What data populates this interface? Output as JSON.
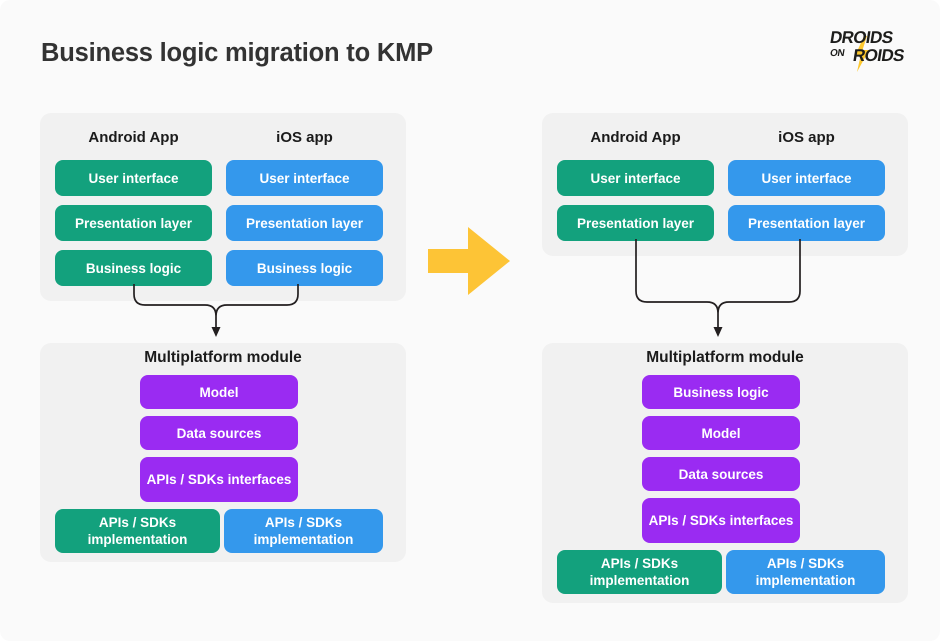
{
  "title": "Business logic migration to KMP",
  "logo": {
    "line1": "DROIDS",
    "line2": "ON",
    "line3": "ROIDS",
    "bolt_color": "#fdc82f"
  },
  "colors": {
    "page_background": "#fafafa",
    "panel_background": "#f1f1f1",
    "android_green": "#13a17d",
    "ios_blue": "#3498ec",
    "multiplatform_purple": "#9a2bf2",
    "arrow_yellow": "#fdc436",
    "connector_stroke": "#231f20",
    "title_text": "#333333"
  },
  "center_arrow": {
    "name": "migration-arrow",
    "direction": "right",
    "color": "#fdc436"
  },
  "before": {
    "apps_panel": {
      "columns": [
        {
          "heading": "Android App",
          "color": "green",
          "boxes": [
            "User interface",
            "Presentation layer",
            "Business logic"
          ]
        },
        {
          "heading": "iOS app",
          "color": "blue",
          "boxes": [
            "User interface",
            "Presentation layer",
            "Business logic"
          ]
        }
      ]
    },
    "module_panel": {
      "heading": "Multiplatform module",
      "shared_boxes": [
        "Model",
        "Data sources",
        "APIs / SDKs interfaces"
      ],
      "platform_boxes": [
        {
          "label": "APIs / SDKs implementation",
          "color": "green"
        },
        {
          "label": "APIs / SDKs implementation",
          "color": "blue"
        }
      ]
    }
  },
  "after": {
    "apps_panel": {
      "columns": [
        {
          "heading": "Android App",
          "color": "green",
          "boxes": [
            "User interface",
            "Presentation layer"
          ]
        },
        {
          "heading": "iOS app",
          "color": "blue",
          "boxes": [
            "User interface",
            "Presentation layer"
          ]
        }
      ]
    },
    "module_panel": {
      "heading": "Multiplatform module",
      "shared_boxes": [
        "Business logic",
        "Model",
        "Data sources",
        "APIs / SDKs interfaces"
      ],
      "platform_boxes": [
        {
          "label": "APIs / SDKs implementation",
          "color": "green"
        },
        {
          "label": "APIs / SDKs implementation",
          "color": "blue"
        }
      ]
    }
  }
}
